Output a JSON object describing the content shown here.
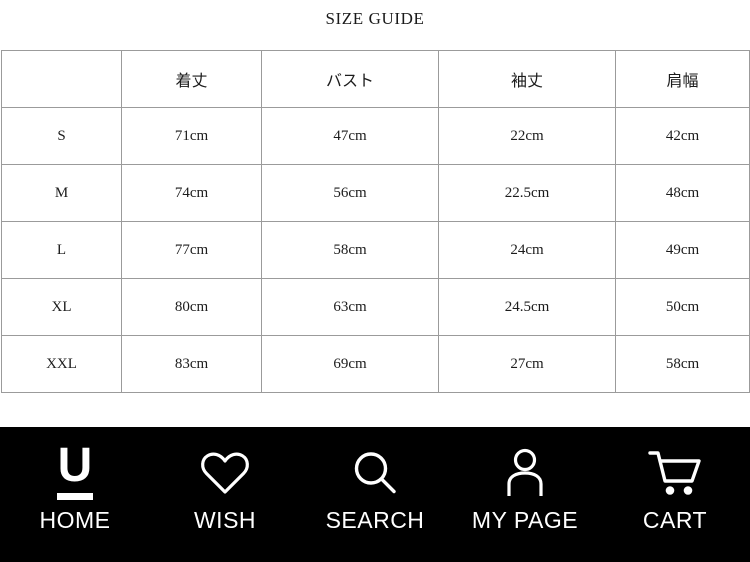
{
  "page": {
    "title": "SIZE GUIDE"
  },
  "size_table": {
    "headers": [
      "",
      "着丈",
      "バスト",
      "袖丈",
      "肩幅"
    ],
    "rows": [
      {
        "size": "S",
        "length": "71cm",
        "bust": "47cm",
        "sleeve": "22cm",
        "shoulder": "42cm"
      },
      {
        "size": "M",
        "length": "74cm",
        "bust": "56cm",
        "sleeve": "22.5cm",
        "shoulder": "48cm"
      },
      {
        "size": "L",
        "length": "77cm",
        "bust": "58cm",
        "sleeve": "24cm",
        "shoulder": "49cm"
      },
      {
        "size": "XL",
        "length": "80cm",
        "bust": "63cm",
        "sleeve": "24.5cm",
        "shoulder": "50cm"
      },
      {
        "size": "XXL",
        "length": "83cm",
        "bust": "69cm",
        "sleeve": "27cm",
        "shoulder": "58cm"
      }
    ]
  },
  "bottom_nav": {
    "background_color": "#000000",
    "text_color": "#ffffff",
    "items": [
      {
        "label": "HOME",
        "icon": "u-logo-icon"
      },
      {
        "label": "WISH",
        "icon": "heart-icon"
      },
      {
        "label": "SEARCH",
        "icon": "magnifier-icon"
      },
      {
        "label": "MY PAGE",
        "icon": "person-icon"
      },
      {
        "label": "CART",
        "icon": "shopping-cart-icon"
      }
    ],
    "home_logo_letter": "U"
  }
}
